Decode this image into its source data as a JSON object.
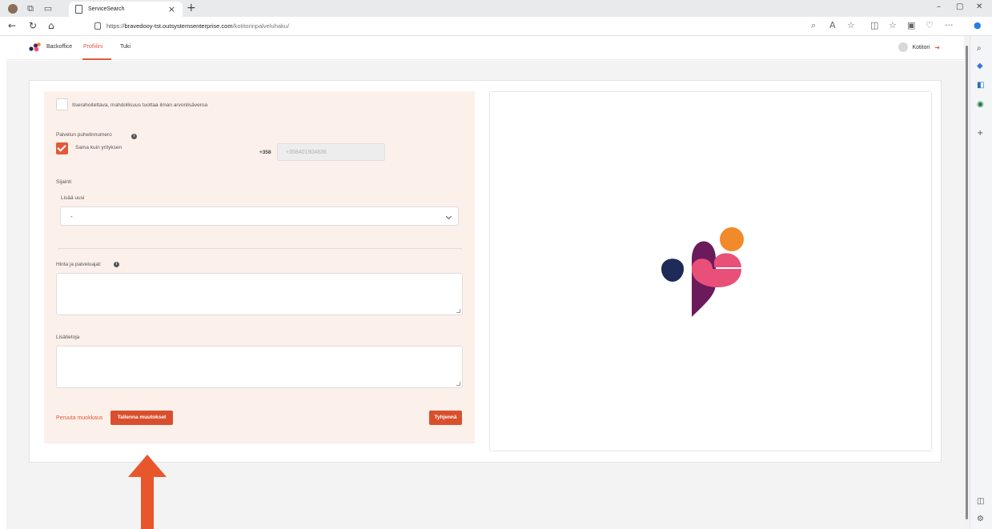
{
  "browser": {
    "tab_title": "ServiceSearch",
    "url_prefix": "https://",
    "url_host": "bravedooy-tst.outsystemsenterprise.com",
    "url_path": "/kotitorinpalveluhaku/"
  },
  "app": {
    "brand": "Backoffice",
    "nav": [
      {
        "label": "Profiilini",
        "active": true
      },
      {
        "label": "Tuki",
        "active": false
      }
    ],
    "user_name": "Kotitori"
  },
  "form": {
    "vat_free_label": "Itserahoitettava, mahdollisuus tuottaa ilman arvonlisäveroa",
    "vat_free_checked": false,
    "phone_section_label": "Palvelun puhelinnumero",
    "same_as_company_label": "Sama kuin yrityksen",
    "same_as_company_checked": true,
    "country_code": "+358",
    "phone_value": "+358401904836",
    "location_section_label": "Sijainti",
    "add_new_label": "Lisää uusi",
    "location_select_value": "-",
    "price_label": "Hinta ja palveluajat:",
    "extra_info_label": "Lisätietoja",
    "cancel_link": "Peruuta muokkaus",
    "save_button": "Tallenna muutokset",
    "clear_button": "Tyhjennä"
  },
  "colors": {
    "accent": "#e25a3a",
    "panel_bg": "#fcf0ea",
    "arrow": "#e8572b"
  }
}
